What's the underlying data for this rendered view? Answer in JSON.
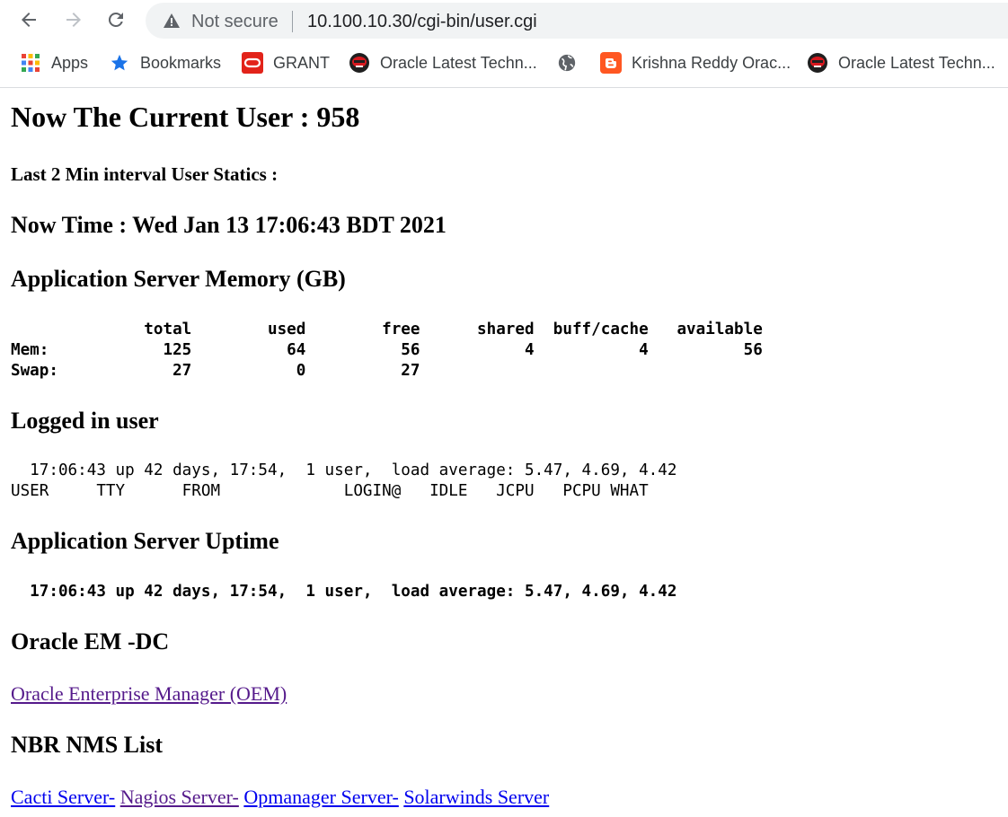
{
  "browser": {
    "security_label": "Not secure",
    "url": "10.100.10.30/cgi-bin/user.cgi",
    "bookmarks": [
      {
        "label": "Apps",
        "icon": "apps-grid-icon"
      },
      {
        "label": "Bookmarks",
        "icon": "star-icon"
      },
      {
        "label": "GRANT",
        "icon": "oracle-icon"
      },
      {
        "label": "Oracle Latest Techn...",
        "icon": "oracle-mask-icon"
      },
      {
        "label": "",
        "icon": "globe-icon"
      },
      {
        "label": "Krishna Reddy Orac...",
        "icon": "blogger-icon"
      },
      {
        "label": "Oracle Latest Techn...",
        "icon": "oracle-mask-icon"
      }
    ],
    "colors": {
      "apps_red": "#ea4335",
      "star_blue": "#1a73e8",
      "oracle_red": "#e2231a",
      "blogger_orange": "#ff5722"
    }
  },
  "page": {
    "current_user": "Now The Current User : 958",
    "interval_stats": "Last 2 Min interval User Statics :",
    "now_time": "Now Time : Wed Jan 13 17:06:43 BDT 2021",
    "memory_heading": "Application Server Memory (GB)",
    "memory_table": "              total        used        free      shared  buff/cache   available\nMem:            125          64          56           4           4          56\nSwap:            27           0          27",
    "logged_heading": "Logged in user",
    "logged_block": "  17:06:43 up 42 days, 17:54,  1 user,  load average: 5.47, 4.69, 4.42\nUSER     TTY      FROM             LOGIN@   IDLE   JCPU   PCPU WHAT",
    "uptime_heading": "Application Server Uptime",
    "uptime_block": "  17:06:43 up 42 days, 17:54,  1 user,  load average: 5.47, 4.69, 4.42",
    "oem_heading": "Oracle EM -DC",
    "oem_link": "Oracle Enterprise Manager (OEM)",
    "nms_heading": "NBR NMS List",
    "nms_links": [
      "Cacti Server-",
      "Nagios Server-",
      "Opmanager Server-",
      "Solarwinds Server"
    ],
    "link_colors": {
      "unvisited": "#0000ee",
      "visited": "#551a8b"
    }
  }
}
